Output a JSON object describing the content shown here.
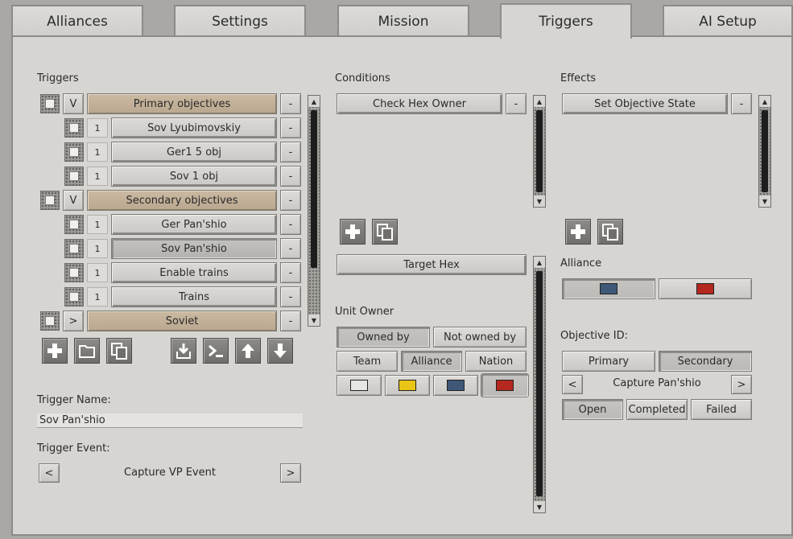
{
  "tabs": [
    "Alliances",
    "Settings",
    "Mission",
    "Triggers",
    "AI Setup"
  ],
  "active_tab": "Triggers",
  "triggers": {
    "title": "Triggers",
    "rows": [
      {
        "toggle": "V",
        "label": "Primary objectives",
        "kind": "header"
      },
      {
        "num": "1",
        "label": "Sov Lyubimovskiy",
        "kind": "item"
      },
      {
        "num": "1",
        "label": "Ger1 5 obj",
        "kind": "item"
      },
      {
        "num": "1",
        "label": "Sov  1 obj",
        "kind": "item"
      },
      {
        "toggle": "V",
        "label": "Secondary objectives",
        "kind": "header"
      },
      {
        "num": "1",
        "label": "Ger Pan'shio",
        "kind": "item"
      },
      {
        "num": "1",
        "label": "Sov Pan'shio",
        "kind": "item"
      },
      {
        "num": "1",
        "label": "Enable trains",
        "kind": "item"
      },
      {
        "num": "1",
        "label": "Trains",
        "kind": "item"
      },
      {
        "toggle": ">",
        "label": "Soviet",
        "kind": "header"
      }
    ],
    "remove_label": "-",
    "name_label": "Trigger Name:",
    "name_value": "Sov Pan'shio",
    "event_label": "Trigger Event:",
    "event_value": "Capture VP Event",
    "prev": "<",
    "next": ">"
  },
  "conditions": {
    "title": "Conditions",
    "items": [
      "Check Hex Owner"
    ],
    "target": "Target Hex",
    "unit_owner_label": "Unit Owner",
    "owned_by": "Owned by",
    "not_owned_by": "Not owned by",
    "team": "Team",
    "alliance": "Alliance",
    "nation": "Nation",
    "colors": [
      "#e6e6e4",
      "#e8c516",
      "#3f5878",
      "#b52820"
    ]
  },
  "effects": {
    "title": "Effects",
    "items": [
      "Set Objective State"
    ],
    "alliance_label": "Alliance",
    "alliance_colors": [
      "#3f5878",
      "#b52820"
    ],
    "objective_label": "Objective ID:",
    "primary": "Primary",
    "secondary": "Secondary",
    "objective_value": "Capture Pan'shio",
    "prev": "<",
    "next": ">",
    "open": "Open",
    "completed": "Completed",
    "failed": "Failed"
  },
  "colors": {
    "header_tan": "#c0ad95",
    "panel": "#d6d5d1"
  }
}
